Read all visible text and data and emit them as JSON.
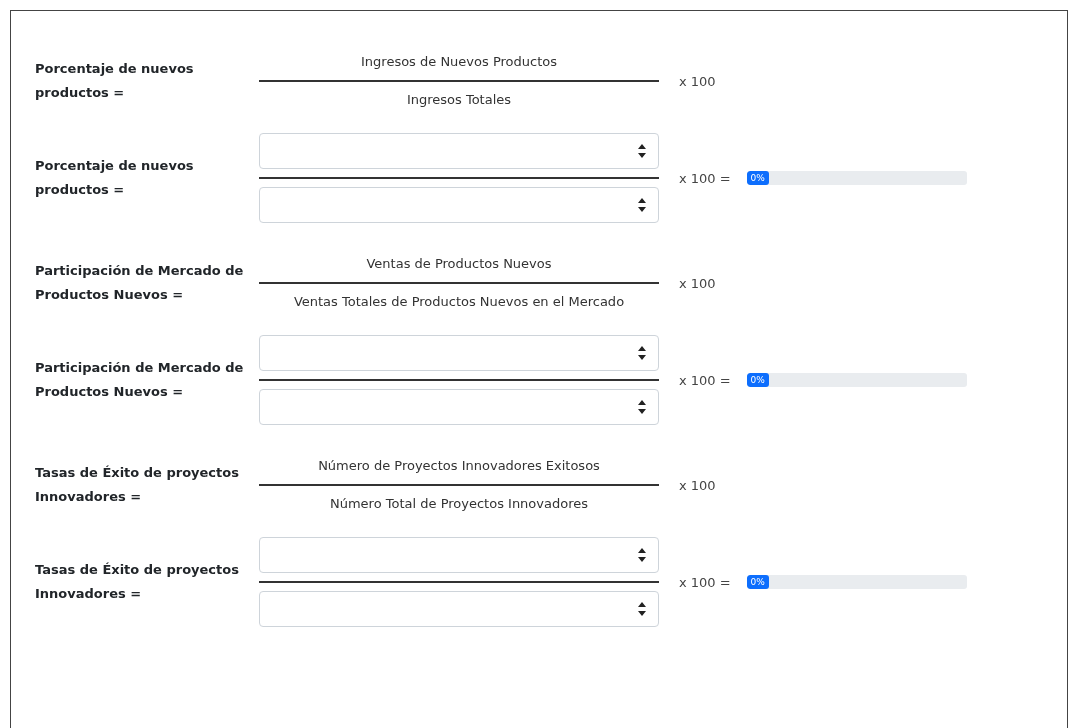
{
  "sections": [
    {
      "formula": {
        "label": "Porcentaje de nuevos productos =",
        "numerator": "Ingresos de Nuevos Productos",
        "denominator": "Ingresos Totales",
        "multiplier": "x 100"
      },
      "calculator": {
        "label": "Porcentaje de nuevos productos =",
        "multiplier": "x 100 =",
        "result": {
          "level": 0,
          "text": "0%"
        }
      }
    },
    {
      "formula": {
        "label": "Participación de Mercado de Productos Nuevos =",
        "numerator": "Ventas de Productos Nuevos",
        "denominator": "Ventas Totales de Productos Nuevos en el Mercado",
        "multiplier": "x 100"
      },
      "calculator": {
        "label": "Participación de Mercado de Productos Nuevos =",
        "multiplier": "x 100 =",
        "result": {
          "level": 0,
          "text": "0%"
        }
      }
    },
    {
      "formula": {
        "label": "Tasas de Éxito de proyectos Innovadores =",
        "numerator": "Número de Proyectos Innovadores Exitosos",
        "denominator": "Número Total de Proyectos Innovadores",
        "multiplier": "x 100"
      },
      "calculator": {
        "label": "Tasas de Éxito de proyectos Innovadores =",
        "multiplier": "x 100 =",
        "result": {
          "level": 0,
          "text": "0%"
        }
      }
    }
  ]
}
